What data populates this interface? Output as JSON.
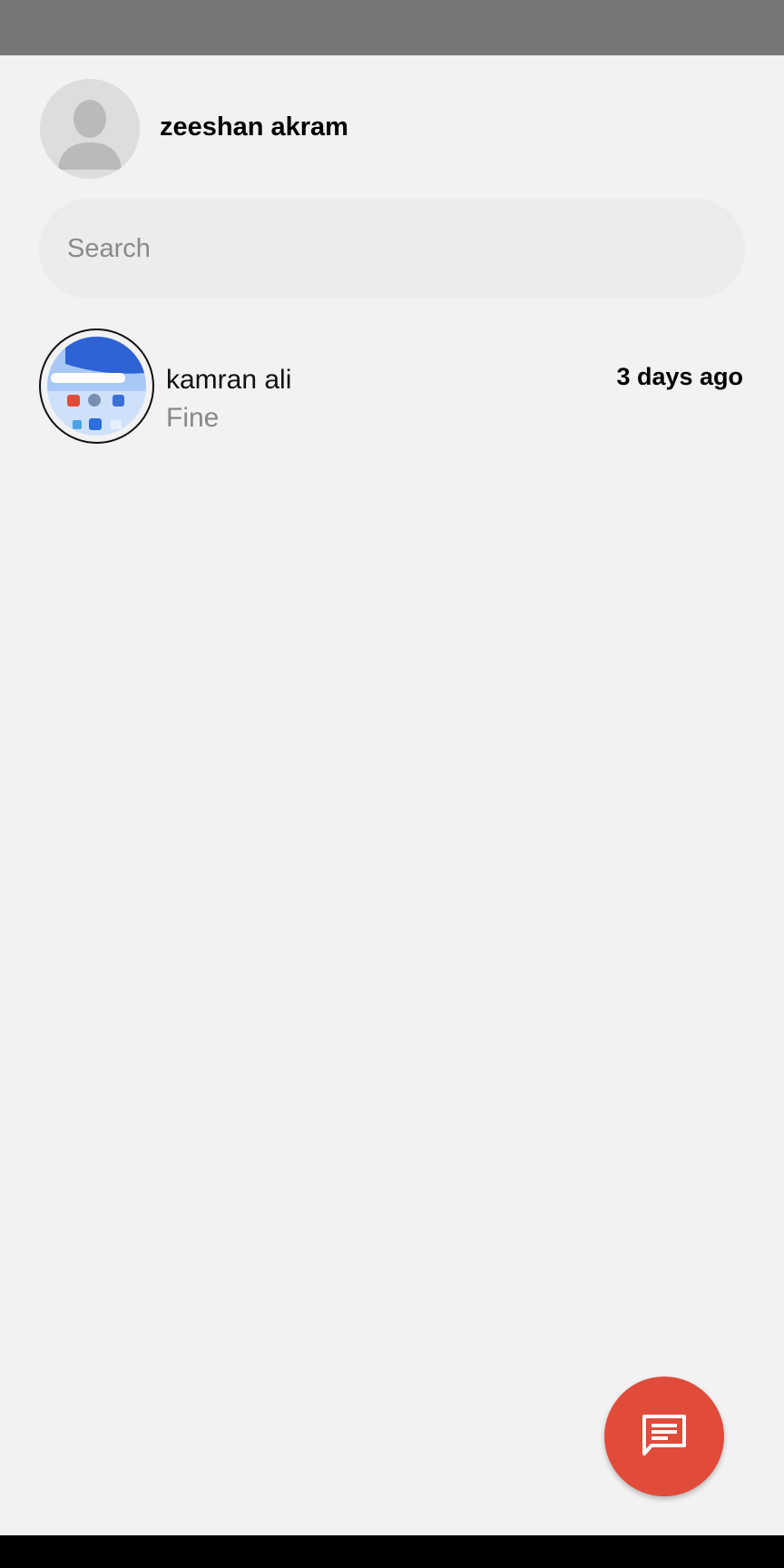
{
  "profile": {
    "name": "zeeshan akram",
    "avatar_icon": "default-person-avatar"
  },
  "search": {
    "placeholder": "Search",
    "value": ""
  },
  "chats": [
    {
      "name": "kamran ali",
      "preview": "Fine",
      "time": "3 days ago",
      "avatar_icon": "phone-screenshot-avatar"
    }
  ],
  "fab": {
    "icon": "new-message-icon"
  },
  "colors": {
    "background": "#f2f2f2",
    "status_bar": "#777777",
    "fab": "#e04b3a",
    "search_box": "#ececec"
  }
}
